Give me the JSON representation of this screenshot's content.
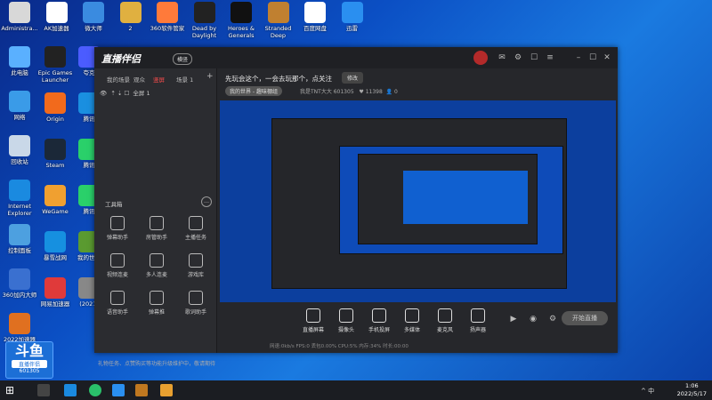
{
  "desktop": {
    "icons_top": [
      {
        "label": "Administra...",
        "color": "#d8d8d8"
      },
      {
        "label": "AK加速器",
        "color": "#ffffff"
      },
      {
        "label": "微大师",
        "color": "#3a8be0"
      },
      {
        "label": "2",
        "color": "#e0b040"
      },
      {
        "label": "360软件管家",
        "color": "#ff7a3a"
      },
      {
        "label": "Dead by Daylight",
        "color": "#222222"
      },
      {
        "label": "Heroes & Generals",
        "color": "#111111"
      },
      {
        "label": "Stranded Deep",
        "color": "#c08030"
      },
      {
        "label": "百度网盘",
        "color": "#ffffff"
      },
      {
        "label": "迅雷",
        "color": "#2a8ff0"
      }
    ],
    "icons_left": [
      {
        "label": "此电脑",
        "color": "#5ab0ff"
      },
      {
        "label": "网络",
        "color": "#3a9be8"
      },
      {
        "label": "回收站",
        "color": "#c9d8e8"
      },
      {
        "label": "Internet Explorer",
        "color": "#1a8ae0"
      },
      {
        "label": "控制面板",
        "color": "#4da0e0"
      },
      {
        "label": "360加内大师",
        "color": "#3a70d0"
      },
      {
        "label": "2022加速器",
        "color": "#e07020"
      }
    ],
    "icons_col2": [
      {
        "label": "Epic Games Launcher",
        "color": "#222222"
      },
      {
        "label": "Origin",
        "color": "#f26a1c"
      },
      {
        "label": "Steam",
        "color": "#1b2838"
      },
      {
        "label": "WeGame",
        "color": "#f0a030"
      },
      {
        "label": "暴雪战网",
        "color": "#1690e0"
      },
      {
        "label": "网易加速器",
        "color": "#e03a3a"
      }
    ],
    "icons_col3": [
      {
        "label": "夸克",
        "color": "#4b5cff"
      },
      {
        "label": "腾讯",
        "color": "#1a8fe0"
      },
      {
        "label": "腾讯",
        "color": "#2ad06a"
      },
      {
        "label": "腾讯",
        "color": "#2ad06a"
      },
      {
        "label": "我的世界",
        "color": "#5a9a30"
      },
      {
        "label": "(2021-",
        "color": "#888888"
      }
    ],
    "badge": {
      "logo": "斗鱼",
      "sub": "直播伴侣",
      "room": "601305"
    }
  },
  "app": {
    "name": "直播伴侣",
    "mode_badge": "横竖",
    "scene_tabs": [
      "我的场景",
      "观众",
      "竖屏",
      "场景 1"
    ],
    "active_scene_tab": 2,
    "scene_item": "全屏 1",
    "tools_title": "工具箱",
    "tools": [
      {
        "label": "弹幕助手",
        "name": "danmu-helper"
      },
      {
        "label": "房管助手",
        "name": "admin-helper"
      },
      {
        "label": "主播任务",
        "name": "streamer-task"
      },
      {
        "label": "视频连麦",
        "name": "video-link"
      },
      {
        "label": "多人连麦",
        "name": "multi-link"
      },
      {
        "label": "游戏库",
        "name": "game-lib"
      },
      {
        "label": "语音助手",
        "name": "voice-helper"
      },
      {
        "label": "弹幕推",
        "name": "danmu-push"
      },
      {
        "label": "歌词助手",
        "name": "lyrics-helper"
      }
    ],
    "warning": "礼物任务、点赞购买等功能升级维护中，敬请期待",
    "stream_title": "先玩会这个，一会去玩那个，点关注",
    "edit_label": "修改",
    "category": "我的世界 - 趣味棚组",
    "room_info": "我是TNT大大  601305",
    "followers": "11398",
    "viewers": "0",
    "controls": [
      {
        "label": "直播屏幕",
        "name": "screen-capture"
      },
      {
        "label": "摄像头",
        "name": "camera"
      },
      {
        "label": "手机投屏",
        "name": "phone-cast"
      },
      {
        "label": "多媒体",
        "name": "multimedia"
      },
      {
        "label": "麦克风",
        "name": "microphone"
      },
      {
        "label": "扬声器",
        "name": "speaker"
      }
    ],
    "go_live": "开始直播",
    "status": "网速:0kb/s    FPS:0    丢包0.00%    CPU:5%    内存:34%    时长:00:00"
  },
  "taskbar": {
    "time": "1:06",
    "date": "2022/5/17",
    "tray_text": "^ 中"
  }
}
